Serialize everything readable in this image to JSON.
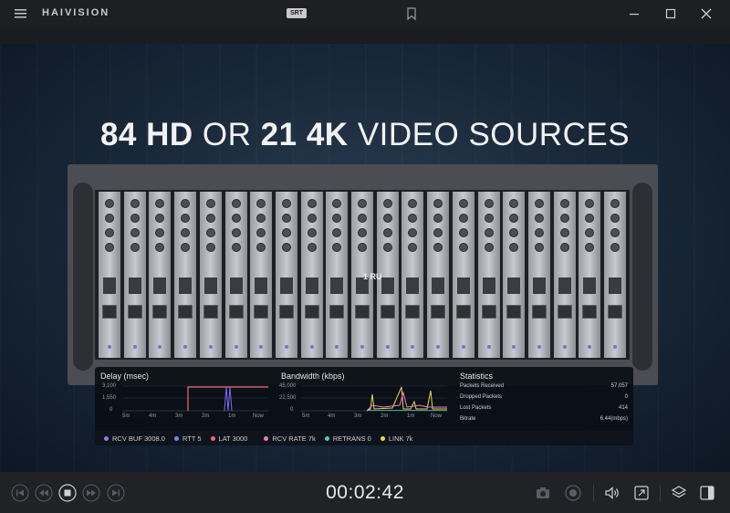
{
  "window": {
    "brand": "HAIVISION",
    "srt_badge": "SRT"
  },
  "video": {
    "headline_num1": "84",
    "headline_hd": "HD",
    "headline_or": "OR",
    "headline_num2": "21",
    "headline_4k": "4K",
    "headline_rest": "VIDEO SOURCES",
    "ru_label": "1 RU"
  },
  "stats": {
    "delay": {
      "title": "Delay (msec)",
      "yticks": [
        "3,100",
        "1,550",
        "0"
      ],
      "xticks": [
        "5m",
        "4m",
        "3m",
        "2m",
        "1m",
        "Now"
      ]
    },
    "bandwidth": {
      "title": "Bandwidth (kbps)",
      "yticks": [
        "45,000",
        "22,500",
        "0"
      ],
      "xticks": [
        "5m",
        "4m",
        "3m",
        "2m",
        "1m",
        "Now"
      ]
    },
    "statistics": {
      "title": "Statistics",
      "rows": [
        {
          "label": "Packets Received",
          "value": "57,057"
        },
        {
          "label": "Dropped Packets",
          "value": "0"
        },
        {
          "label": "Lost Packets",
          "value": "414"
        },
        {
          "label": "Bitrate",
          "value": "6.44(mbps)"
        }
      ]
    },
    "legend": [
      {
        "label": "RCV BUF 3008.0",
        "color": "#9b7be0"
      },
      {
        "label": "RTT 5",
        "color": "#6f8cf0"
      },
      {
        "label": "LAT 3000",
        "color": "#f06a6a"
      },
      {
        "label": "RCV RATE 7k",
        "color": "#f07ac0"
      },
      {
        "label": "RETRANS 0",
        "color": "#4fd0c0"
      },
      {
        "label": "LINK 7k",
        "color": "#e8d94a"
      }
    ]
  },
  "controls": {
    "time": "00:02:42"
  },
  "colors": {
    "titlebar": "#1e1f22",
    "controls": "#202226",
    "accent_lat": "#f06a6a"
  }
}
